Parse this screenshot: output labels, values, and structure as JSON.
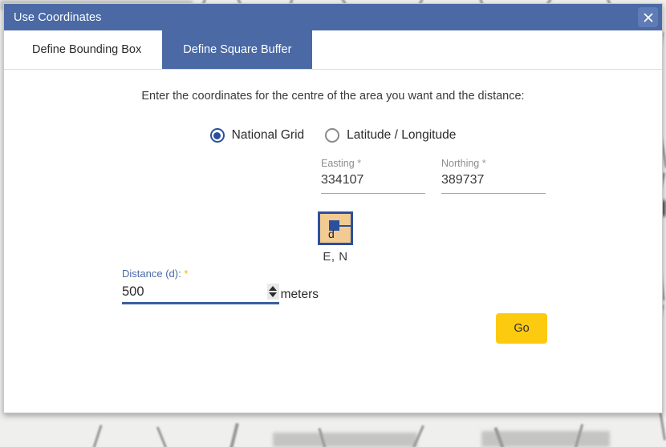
{
  "window": {
    "title": "Use Coordinates",
    "close_icon": "close-icon"
  },
  "tabs": [
    {
      "label": "Define Bounding Box",
      "active": false
    },
    {
      "label": "Define Square Buffer",
      "active": true
    }
  ],
  "main": {
    "instruction": "Enter the coordinates for the centre of the area you want and the distance:",
    "coordinate_modes": [
      {
        "label": "National Grid",
        "selected": true
      },
      {
        "label": "Latitude / Longitude",
        "selected": false
      }
    ],
    "fields": [
      {
        "label": "Easting",
        "required_marker": "*",
        "value": "334107"
      },
      {
        "label": "Northing",
        "required_marker": "*",
        "value": "389737"
      }
    ],
    "diagram": {
      "name": "square-buffer-diagram",
      "distance_label": "d",
      "caption": "E, N"
    },
    "distance": {
      "label": "Distance (d):",
      "required_marker": "*",
      "value": "500",
      "units": "meters",
      "spinner_up_icon": "spinner-up-icon",
      "spinner_down_icon": "spinner-down-icon"
    },
    "go_button": "Go"
  },
  "colors": {
    "titlebar": "#4a69a5",
    "tab_active": "#4a69a5",
    "accent_blue": "#2b4f9e",
    "go_button": "#fccb10",
    "required_star": "#f1b500",
    "diagram_fill": "#f2cb92"
  }
}
